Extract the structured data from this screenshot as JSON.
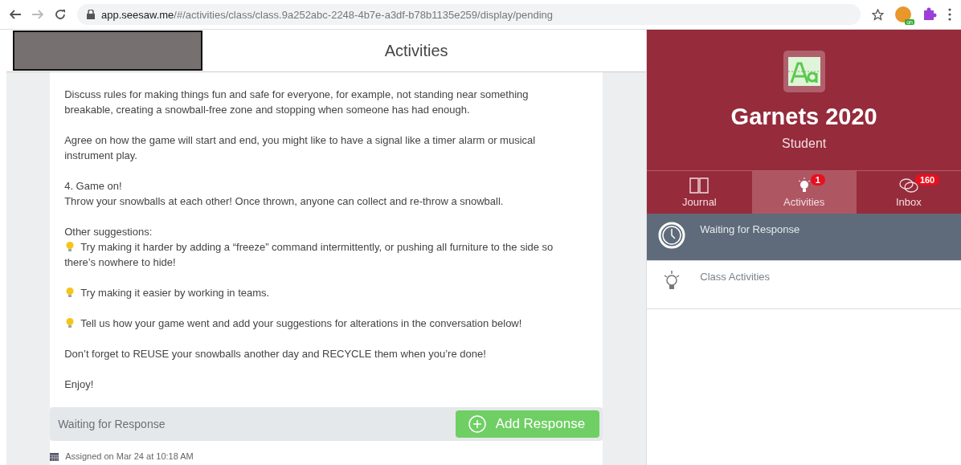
{
  "browser": {
    "url_host": "app.seesaw.me",
    "url_path": "/#/activities/class/class.9a252abc-2248-4b7e-a3df-b78b1135e259/display/pending",
    "extension_badge": "on"
  },
  "main": {
    "title": "Activities",
    "blocks": [
      {
        "lines": [
          {
            "kind": "text",
            "text": "Discuss rules for making things fun and safe for everyone, for example, not standing near something breakable, creating a snowball-free zone and stopping when someone has had enough."
          }
        ]
      },
      {
        "lines": [
          {
            "kind": "text",
            "text": "Agree on how the game will start and end, you might like to have a signal like a timer alarm or musical instrument play."
          }
        ]
      },
      {
        "lines": [
          {
            "kind": "text",
            "text": "4. Game on!"
          },
          {
            "kind": "text",
            "text": "Throw your snowballs at each other! Once thrown, anyone can collect and re-throw a snowball."
          }
        ]
      },
      {
        "lines": [
          {
            "kind": "text",
            "text": "Other suggestions:"
          },
          {
            "kind": "tip",
            "text": "Try making it harder by adding a “freeze” command intermittently, or pushing all furniture to the side so there’s nowhere to hide!"
          }
        ]
      },
      {
        "lines": [
          {
            "kind": "tip",
            "text": "Try making it easier by working in teams."
          }
        ]
      },
      {
        "lines": [
          {
            "kind": "tip",
            "text": "Tell us how your game went and add your suggestions for alterations in the conversation below!"
          }
        ]
      },
      {
        "lines": [
          {
            "kind": "text",
            "text": "Don’t forget to REUSE your snowballs another day and RECYCLE them when you’re done!"
          }
        ]
      },
      {
        "lines": [
          {
            "kind": "text",
            "text": "Enjoy!"
          }
        ]
      }
    ],
    "status": "Waiting for Response",
    "action": "Add Response",
    "assigned": "Assigned on Mar 24 at 10:18 AM"
  },
  "sidebar": {
    "class_name": "Garnets 2020",
    "role": "Student",
    "tabs": [
      {
        "kind": "journal",
        "label": "Journal",
        "selected": false
      },
      {
        "kind": "activities",
        "label": "Activities",
        "selected": true,
        "badge": "1"
      },
      {
        "kind": "inbox",
        "label": "Inbox",
        "selected": false,
        "badge": "160"
      }
    ],
    "items": [
      {
        "kind": "clock",
        "label": "Waiting for Response",
        "selected": true
      },
      {
        "kind": "bulb",
        "label": "Class Activities",
        "selected": false
      }
    ]
  }
}
